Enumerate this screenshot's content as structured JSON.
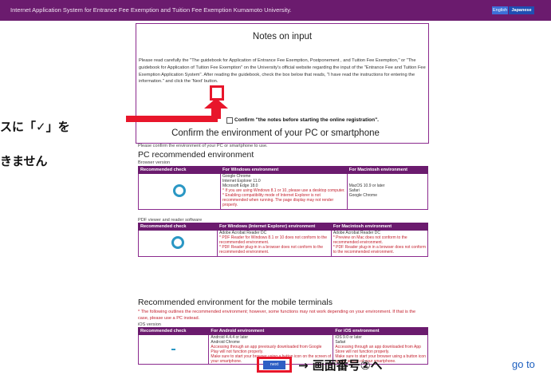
{
  "header": {
    "title": "Internet Application System for Entrance Fee Exemption and Tuition Fee Exemption Kumamoto University.",
    "lang_en": "English",
    "lang_ja": "Japanese"
  },
  "notes": {
    "heading": "Notes on input",
    "body": "Please read carefully the \"The guidebook for Application of Entrance Fee Exemption, Postponement , and Tuition Fee Exemption,\" or \"The guidebook for Application of Tuition Fee Exemption\" on the University's official website regarding the input of the \"Entrance Fee and Tuition Fee Exemption Application System\". After reading the guidebook, check the box below that reads, \"I have read the instructions for entering the information.\" and click the 'Next' button.",
    "confirm_label": "Confirm \"the notes before starting the online registration\"."
  },
  "annotations": {
    "check_instruction": "スに「✓」を",
    "side_text2": "きません",
    "next_arrow": "→ 画面番号②へ",
    "goto_link": "go to"
  },
  "env": {
    "heading": "Confirm the environment of your PC or smartphone",
    "intro": "Please confirm the environment of your PC or smartphone to use.",
    "pc_heading": "PC recommended environment",
    "browser_label": "Browser version",
    "pdf_label": "PDF viewer and reader software",
    "mobile_heading": "Recommended environment for the mobile terminals",
    "mobile_note": "* The following outlines the recommended environment; however, some functions may not work depending on your environment. If that is the case, please use a PC instead.",
    "ios_label": "iOS version"
  },
  "browser_table": {
    "headers": [
      "Recommended check",
      "For Windows environment",
      "For Macintosh environment"
    ],
    "mark": "circle",
    "windows": [
      {
        "text": "Google Chrome",
        "red": false
      },
      {
        "text": "Internet Explorer 11.0",
        "red": false
      },
      {
        "text": "Microsoft Edge 18.0",
        "red": false
      },
      {
        "text": "* If you are using Windows 8.1 or 10, please use a desktop computer.",
        "red": true
      },
      {
        "text": "* Enabling compatibility mode of Internet Explorer is not",
        "red": true
      },
      {
        "text": "recommended when running. The page display may not render",
        "red": true
      },
      {
        "text": "properly.",
        "red": true
      }
    ],
    "mac": [
      {
        "text": "MacOS 10.9 or later",
        "red": false
      },
      {
        "text": "Safari",
        "red": false
      },
      {
        "text": "Google Chrome",
        "red": false
      }
    ]
  },
  "pdf_table": {
    "headers": [
      "Recommended check",
      "For Windows (Internet Explorer) environment",
      "For Macintosh environment"
    ],
    "mark": "circle",
    "windows": [
      {
        "text": "Adobe Acrobat Reader DC",
        "red": false
      },
      {
        "text": "* PDF Reader for Windows 8.1 or 10 does not conform to the",
        "red": true
      },
      {
        "text": "recommended environment.",
        "red": true
      },
      {
        "text": "* PDF Reader plug-in in a browser does not conform to the",
        "red": true
      },
      {
        "text": "recommended environment.",
        "red": true
      }
    ],
    "mac": [
      {
        "text": "Adobe Acrobat Reader DC",
        "red": false
      },
      {
        "text": "* Preview on Mac does not conform to the",
        "red": true
      },
      {
        "text": "recommended environment.",
        "red": true
      },
      {
        "text": "* PDF Reader plug-in in a browser does not conform",
        "red": true
      },
      {
        "text": "to the recommended environment.",
        "red": true
      }
    ]
  },
  "mobile_table": {
    "headers": [
      "Recommended check",
      "For Android environment",
      "For iOS environment"
    ],
    "mark": "dash",
    "android": [
      {
        "text": "Android 4.4.4 or later",
        "red": false
      },
      {
        "text": "Android Chrome",
        "red": false
      },
      {
        "text": "Accessing through an app previously downloaded from Google",
        "red": true
      },
      {
        "text": "Play will not function properly.",
        "red": true
      },
      {
        "text": "Make sure to start your browser using a button icon on the screen of",
        "red": true
      },
      {
        "text": "your smartphone.",
        "red": true
      }
    ],
    "ios": [
      {
        "text": "iOS 9.0 or later",
        "red": false
      },
      {
        "text": "Safari",
        "red": false
      },
      {
        "text": "Accessing through an app downloaded from App",
        "red": true
      },
      {
        "text": "Store will not function properly.",
        "red": true
      },
      {
        "text": "Make sure to start your browser using a button icon",
        "red": true
      },
      {
        "text": "on the screen of your smartphone.",
        "red": true
      }
    ]
  },
  "buttons": {
    "next_label": "next"
  }
}
